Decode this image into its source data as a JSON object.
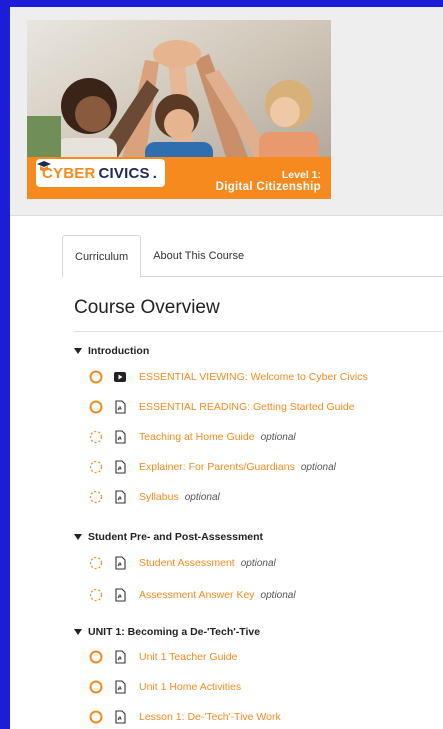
{
  "course": {
    "brand_cyber": "CYBER",
    "brand_civics": "CIVICS",
    "brand_dot": ".",
    "level": "Level 1:",
    "level_name": "Digital Citizenship"
  },
  "tabs": [
    {
      "label": "Curriculum",
      "active": true
    },
    {
      "label": "About This Course",
      "active": false
    }
  ],
  "overview_title": "Course Overview",
  "colors": {
    "accent": "#f68a1f",
    "page_bg": "#1b1ed6",
    "brand_navy": "#1f2a5c"
  },
  "sections": [
    {
      "title": "Introduction",
      "items": [
        {
          "label": "ESSENTIAL VIEWING: Welcome to Cyber Civics",
          "optional": "",
          "status": "open-circle",
          "type": "video-icon"
        },
        {
          "label": "ESSENTIAL READING: Getting Started Guide",
          "optional": "",
          "status": "open-circle",
          "type": "pdf-icon"
        },
        {
          "label": "Teaching at Home Guide",
          "optional": "optional",
          "status": "dashed-circle",
          "type": "pdf-icon"
        },
        {
          "label": "Explainer: For Parents/Guardians",
          "optional": "optional",
          "status": "dashed-circle",
          "type": "pdf-icon"
        },
        {
          "label": "Syllabus",
          "optional": "optional",
          "status": "dashed-circle",
          "type": "pdf-icon"
        }
      ]
    },
    {
      "title": "Student Pre- and Post-Assessment",
      "items": [
        {
          "label": "Student Assessment",
          "optional": "optional",
          "status": "dashed-circle",
          "type": "pdf-icon"
        },
        {
          "label": "Assessment Answer Key",
          "optional": "optional",
          "status": "dashed-circle",
          "type": "pdf-icon"
        }
      ]
    },
    {
      "title": "UNIT 1: Becoming a De-'Tech'-Tive",
      "items": [
        {
          "label": "Unit 1 Teacher Guide",
          "optional": "",
          "status": "open-circle",
          "type": "pdf-icon"
        },
        {
          "label": "Unit 1 Home Activities",
          "optional": "",
          "status": "open-circle",
          "type": "pdf-icon"
        },
        {
          "label": "Lesson 1: De-'Tech'-Tive Work",
          "optional": "",
          "status": "open-circle",
          "type": "pdf-icon"
        }
      ]
    }
  ]
}
